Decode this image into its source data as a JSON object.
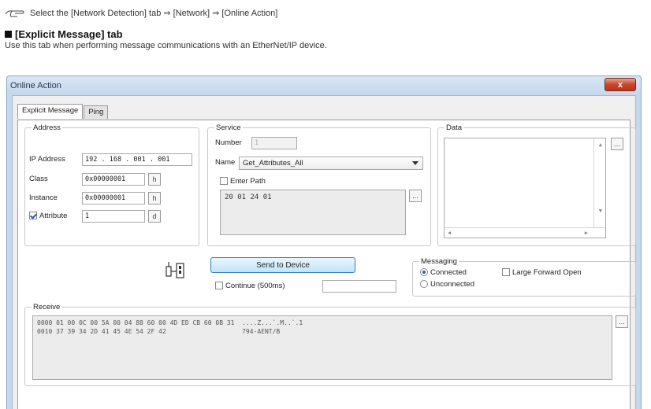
{
  "doc": {
    "menu_path": "Select the [Network Detection] tab ⇒ [Network] ⇒ [Online Action]",
    "section_title": "[Explicit Message] tab",
    "section_desc": "Use this tab when performing message communications with an EtherNet/IP device."
  },
  "window": {
    "title": "Online Action",
    "close_label": "x"
  },
  "tabs": [
    {
      "label": "Explicit Message",
      "active": true
    },
    {
      "label": "Ping",
      "active": false
    }
  ],
  "address": {
    "legend": "Address",
    "ip_label": "IP Address",
    "ip_value": "192 . 168 . 001 . 001",
    "class_label": "Class",
    "class_value": "0x00000001",
    "class_btn": "h",
    "instance_label": "Instance",
    "instance_value": "0x00000001",
    "instance_btn": "h",
    "attribute_label": "Attribute",
    "attribute_checked": true,
    "attribute_value": "1",
    "attribute_btn": "d"
  },
  "service": {
    "legend": "Service",
    "number_label": "Number",
    "number_value": "1",
    "name_label": "Name",
    "name_value": "Get_Attributes_All",
    "enter_path_label": "Enter Path",
    "path_value": "20 01 24 01",
    "edit_btn": "..."
  },
  "data_box": {
    "legend": "Data",
    "edit_btn": "..."
  },
  "send": {
    "button_label": "Send to Device",
    "continue_label": "Continue (500ms)",
    "continue_value": ""
  },
  "messaging": {
    "legend": "Messaging",
    "connected_label": "Connected",
    "unconnected_label": "Unconnected",
    "large_forward_open_label": "Large Forward Open",
    "selected": "Connected"
  },
  "receive": {
    "legend": "Receive",
    "lines": [
      "0000 01 00 0C 00 5A 00 04 88 60 00 4D ED CB 60 0B 31  ....Z...`.M..`.1",
      "0010 37 39 34 2D 41 45 4E 54 2F 42                    794-AENT/B"
    ],
    "edit_btn": "..."
  },
  "colors": {
    "title_bar": "#c6d8ec",
    "close_button": "#c9442a",
    "send_button": "#bee6fd",
    "check_mark": "#2b5fa8"
  },
  "icons": [
    "hand-pointer-icon",
    "device-connector-icon",
    "scroll-up-icon",
    "scroll-down-icon",
    "scroll-left-icon",
    "scroll-right-icon"
  ]
}
